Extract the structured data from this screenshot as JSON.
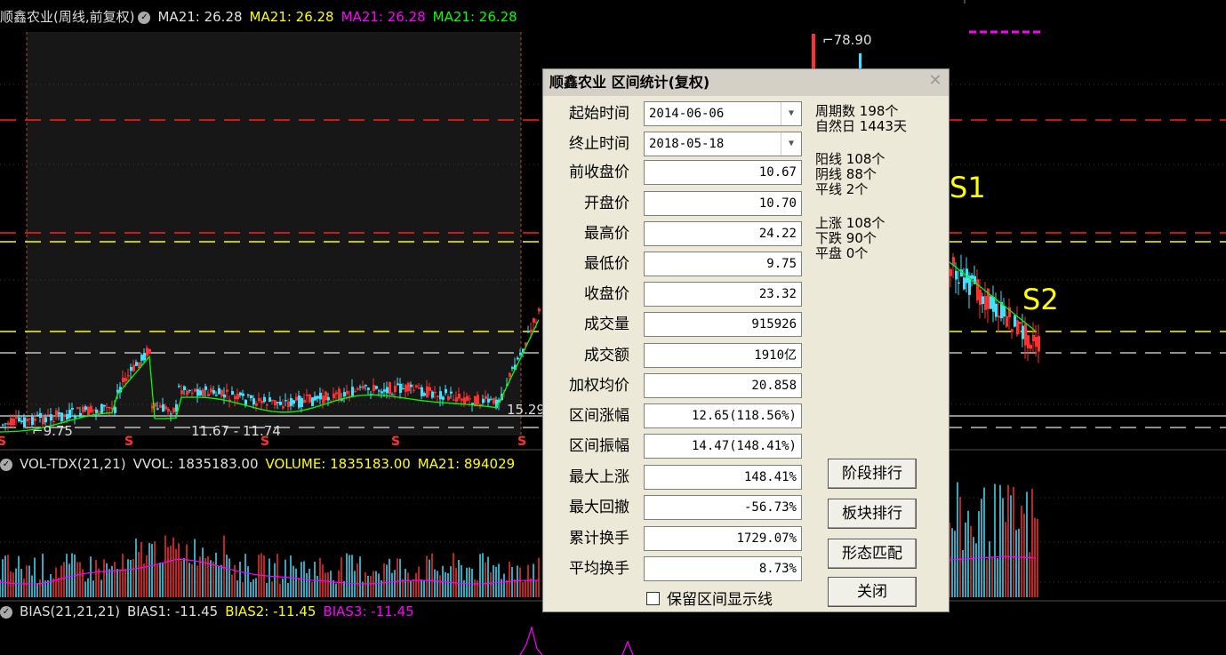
{
  "main_legend": {
    "title": "顺鑫农业(周线,前复权)",
    "ma1": "MA21: 26.28",
    "ma2": "MA21: 26.28",
    "ma3": "MA21: 26.28",
    "ma4": "MA21: 26.28"
  },
  "chart_labels": {
    "high_price": "78.90",
    "low_price": "9.75",
    "mid_label": "11.67 - 11.74",
    "right_price": "15.29",
    "s1": "S1",
    "s2": "S2",
    "s_marker": "S"
  },
  "vol_legend": {
    "name": "VOL-TDX(21,21)",
    "vvol": "VVOL: 1835183.00",
    "volume": "VOLUME: 1835183.00",
    "ma21": "MA21: 894029"
  },
  "bias_legend": {
    "name": "BIAS(21,21,21)",
    "bias1": "BIAS1: -11.45",
    "bias2": "BIAS2: -11.45",
    "bias3": "BIAS3: -11.45"
  },
  "colors": {
    "ma_white": "#e0e0e0",
    "ma_yellow": "#ffff00",
    "ma_magenta": "#ff00ff",
    "ma_green": "#00ff00",
    "candle_up": "#ff3030",
    "candle_down": "#40e0ff"
  },
  "dialog": {
    "title": "顺鑫农业 区间统计(复权)",
    "close_glyph": "✕",
    "fields": [
      {
        "label": "起始时间",
        "value": "2014-06-06"
      },
      {
        "label": "终止时间",
        "value": "2018-05-18"
      },
      {
        "label": "前收盘价",
        "value": "10.67"
      },
      {
        "label": "开盘价",
        "value": "10.70"
      },
      {
        "label": "最高价",
        "value": "24.22"
      },
      {
        "label": "最低价",
        "value": "9.75"
      },
      {
        "label": "收盘价",
        "value": "23.32"
      },
      {
        "label": "成交量",
        "value": "915926"
      },
      {
        "label": "成交额",
        "value": "1910亿"
      },
      {
        "label": "加权均价",
        "value": "20.858"
      },
      {
        "label": "区间涨幅",
        "value": "12.65(118.56%)"
      },
      {
        "label": "区间振幅",
        "value": "14.47(148.41%)"
      },
      {
        "label": "最大上涨",
        "value": "148.41%"
      },
      {
        "label": "最大回撤",
        "value": "-56.73%"
      },
      {
        "label": "累计换手",
        "value": "1729.07%"
      },
      {
        "label": "平均换手",
        "value": "8.73%"
      }
    ],
    "stats": {
      "periods_label": "周期数",
      "periods_value": "198个",
      "days_label": "自然日",
      "days_value": "1443天",
      "yang_label": "阳线",
      "yang_value": "108个",
      "yin_label": "阴线",
      "yin_value": "88个",
      "flat_label": "平线",
      "flat_value": "2个",
      "up_label": "上涨",
      "up_value": "108个",
      "down_label": "下跌",
      "down_value": "90个",
      "even_label": "平盘",
      "even_value": "0个"
    },
    "buttons": {
      "stage_rank": "阶段排行",
      "sector_rank": "板块排行",
      "pattern_match": "形态匹配",
      "close": "关闭"
    },
    "keep_lines_label": "保留区间显示线"
  }
}
